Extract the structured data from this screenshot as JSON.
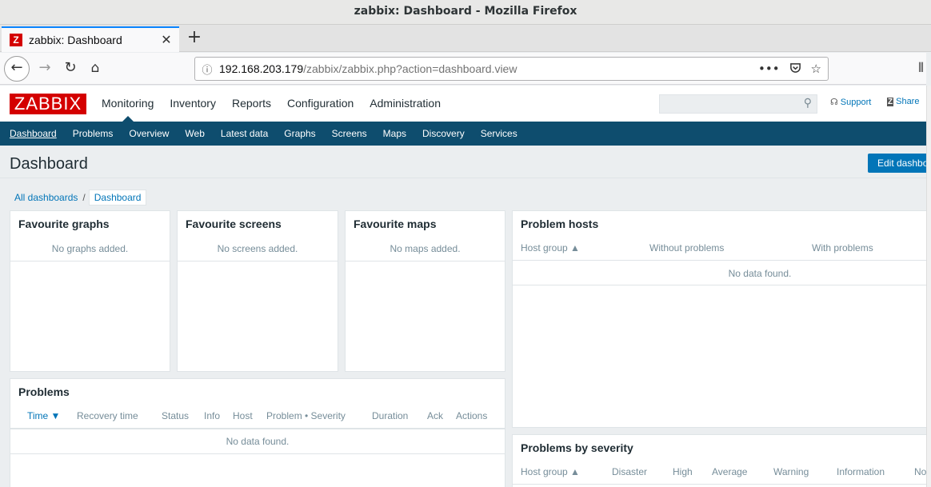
{
  "window": {
    "title": "zabbix: Dashboard - Mozilla Firefox"
  },
  "browser": {
    "tab_title": "zabbix: Dashboard",
    "tab_favicon": "Z",
    "url_host": "192.168.203.179",
    "url_path": "/zabbix/zabbix.php?action=dashboard.view",
    "icons": [
      "back-icon",
      "forward-icon",
      "reload-icon",
      "home-icon",
      "info-icon",
      "more-icon",
      "pocket-icon",
      "bookmark-star-icon"
    ]
  },
  "header": {
    "logo": "ZABBIX",
    "menu": [
      "Monitoring",
      "Inventory",
      "Reports",
      "Configuration",
      "Administration"
    ],
    "active_menu": "Monitoring",
    "search_placeholder": "",
    "support": "Support",
    "share": "Share"
  },
  "submenu": {
    "items": [
      "Dashboard",
      "Problems",
      "Overview",
      "Web",
      "Latest data",
      "Graphs",
      "Screens",
      "Maps",
      "Discovery",
      "Services"
    ],
    "active": "Dashboard"
  },
  "page": {
    "title": "Dashboard",
    "edit_button": "Edit dashboard",
    "breadcrumb": {
      "all": "All dashboards",
      "separator": "/",
      "current": "Dashboard"
    }
  },
  "widgets": {
    "fav_graphs": {
      "title": "Favourite graphs",
      "message": "No graphs added."
    },
    "fav_screens": {
      "title": "Favourite screens",
      "message": "No screens added."
    },
    "fav_maps": {
      "title": "Favourite maps",
      "message": "No maps added."
    },
    "problem_hosts": {
      "title": "Problem hosts",
      "columns": [
        "Host group ▲",
        "Without problems",
        "With problems"
      ],
      "message": "No data found."
    },
    "problems": {
      "title": "Problems",
      "columns": [
        "Time ▼",
        "Recovery time",
        "Status",
        "Info",
        "Host",
        "Problem • Severity",
        "Duration",
        "Ack",
        "Actions"
      ],
      "message": "No data found."
    },
    "problems_by_severity": {
      "title": "Problems by severity",
      "columns": [
        "Host group ▲",
        "Disaster",
        "High",
        "Average",
        "Warning",
        "Information",
        "No"
      ]
    }
  },
  "colors": {
    "brand": "#d40000",
    "nav": "#0e4d6e",
    "link": "#0275b8"
  }
}
